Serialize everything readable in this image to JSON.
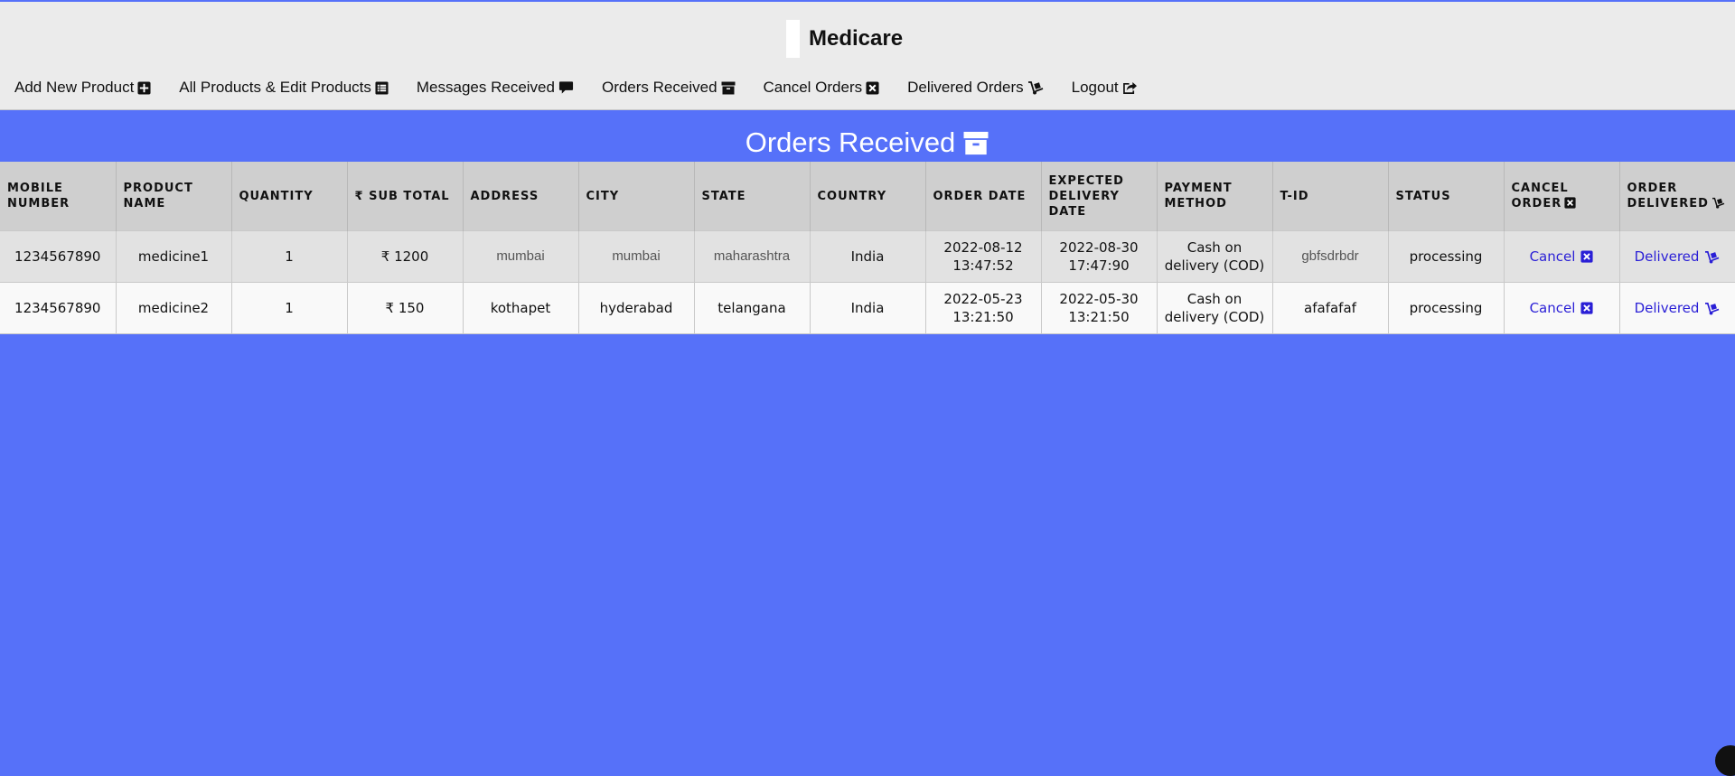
{
  "app": {
    "name": "Medicare"
  },
  "nav": {
    "items": [
      {
        "label": "Add New Product",
        "icon": "plus-square-icon"
      },
      {
        "label": "All Products & Edit Products",
        "icon": "list-icon"
      },
      {
        "label": "Messages Received",
        "icon": "comment-icon"
      },
      {
        "label": "Orders Received",
        "icon": "archive-icon"
      },
      {
        "label": "Cancel Orders",
        "icon": "x-square-icon"
      },
      {
        "label": "Delivered Orders",
        "icon": "dolly-icon"
      },
      {
        "label": "Logout",
        "icon": "share-icon"
      }
    ]
  },
  "page": {
    "title": "Orders Received",
    "title_icon": "archive-icon"
  },
  "table": {
    "headers": {
      "mobile_l1": "MOBILE",
      "mobile_l2": "NUMBER",
      "product_l1": "PRODUCT",
      "product_l2": "NAME",
      "quantity": "QUANTITY",
      "subtotal": "SUB TOTAL",
      "address": "ADDRESS",
      "city": "CITY",
      "state": "STATE",
      "country": "COUNTRY",
      "order_date": "ORDER DATE",
      "exp_l1": "EXPECTED",
      "exp_l2": "DELIVERY",
      "exp_l3": "DATE",
      "pay_l1": "PAYMENT",
      "pay_l2": "METHOD",
      "tid": "T-ID",
      "status": "STATUS",
      "cancel_l1": "CANCEL",
      "cancel_l2": "ORDER",
      "deliv_l1": "ORDER",
      "deliv_l2": "DELIVERED"
    },
    "rows": [
      {
        "mobile": "1234567890",
        "product": "medicine1",
        "quantity": "1",
        "subtotal": "1200",
        "address": "mumbai",
        "city": "mumbai",
        "state": "maharashtra",
        "country": "India",
        "order_date_l1": "2022-08-12",
        "order_date_l2": "13:47:52",
        "exp_date_l1": "2022-08-30",
        "exp_date_l2": "17:47:90",
        "pay_l1": "Cash on",
        "pay_l2": "delivery (COD)",
        "tid": "gbfsdrbdr",
        "status": "processing",
        "cancel_label": "Cancel",
        "delivered_label": "Delivered"
      },
      {
        "mobile": "1234567890",
        "product": "medicine2",
        "quantity": "1",
        "subtotal": "150",
        "address": "kothapet",
        "city": "hyderabad",
        "state": "telangana",
        "country": "India",
        "order_date_l1": "2022-05-23",
        "order_date_l2": "13:21:50",
        "exp_date_l1": "2022-05-30",
        "exp_date_l2": "13:21:50",
        "pay_l1": "Cash on",
        "pay_l2": "delivery (COD)",
        "tid": "afafafaf",
        "status": "processing",
        "cancel_label": "Cancel",
        "delivered_label": "Delivered"
      }
    ]
  },
  "colors": {
    "background": "#5671f9",
    "header_bg": "#ebebeb",
    "table_header_bg": "#cfcfcf",
    "link": "#2a1fd6"
  }
}
